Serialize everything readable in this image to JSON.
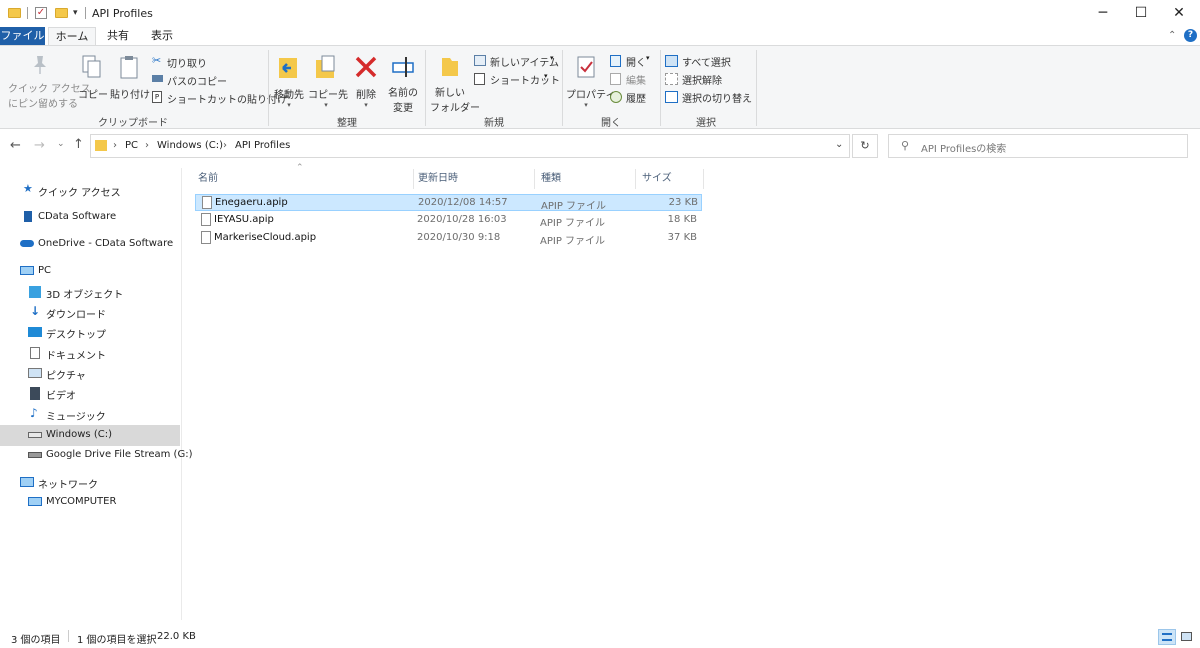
{
  "window": {
    "title": "API Profiles",
    "controls": {
      "minimize": "─",
      "maximize": "☐",
      "close": "✕"
    }
  },
  "ribbon": {
    "tabs": [
      "ファイル",
      "ホーム",
      "共有",
      "表示"
    ],
    "active_tab": "ホーム",
    "clipboard": {
      "pin_line1": "クイック アクセス",
      "pin_line2": "にピン留めする",
      "copy": "コピー",
      "paste": "貼り付け",
      "cut": "切り取り",
      "copy_path": "パスのコピー",
      "paste_shortcut": "ショートカットの貼り付け",
      "group": "クリップボード"
    },
    "organize": {
      "move_to": "移動先",
      "copy_to": "コピー先",
      "delete": "削除",
      "rename_line1": "名前の",
      "rename_line2": "変更",
      "group": "整理"
    },
    "new": {
      "new_folder_line1": "新しい",
      "new_folder_line2": "フォルダー",
      "new_item": "新しいアイテム",
      "shortcut": "ショートカット",
      "group": "新規"
    },
    "open": {
      "properties": "プロパティ",
      "open": "開く",
      "edit": "編集",
      "history": "履歴",
      "group": "開く"
    },
    "select": {
      "select_all": "すべて選択",
      "select_none": "選択解除",
      "invert": "選択の切り替え",
      "group": "選択"
    }
  },
  "address": {
    "breadcrumb": [
      "PC",
      "Windows (C:)",
      "API Profiles"
    ],
    "search_placeholder": "API Profilesの検索"
  },
  "nav": {
    "quick_access": "クイック アクセス",
    "cdata": "CData Software",
    "onedrive": "OneDrive - CData Software",
    "pc": "PC",
    "objects3d": "3D オブジェクト",
    "downloads": "ダウンロード",
    "desktop": "デスクトップ",
    "documents": "ドキュメント",
    "pictures": "ピクチャ",
    "videos": "ビデオ",
    "music": "ミュージック",
    "windows_c": "Windows (C:)",
    "gdrive": "Google Drive File Stream (G:)",
    "network": "ネットワーク",
    "mycomputer": "MYCOMPUTER"
  },
  "columns": {
    "name": "名前",
    "modified": "更新日時",
    "type": "種類",
    "size": "サイズ"
  },
  "files": [
    {
      "name": "Enegaeru.apip",
      "modified": "2020/12/08 14:57",
      "type": "APIP ファイル",
      "size": "23 KB",
      "selected": true
    },
    {
      "name": "IEYASU.apip",
      "modified": "2020/10/28 16:03",
      "type": "APIP ファイル",
      "size": "18 KB",
      "selected": false
    },
    {
      "name": "MarkeriseCloud.apip",
      "modified": "2020/10/30 9:18",
      "type": "APIP ファイル",
      "size": "37 KB",
      "selected": false
    }
  ],
  "status": {
    "item_count": "3 個の項目",
    "selection": "1 個の項目を選択",
    "selection_size": "22.0 KB"
  },
  "colors": {
    "accent": "#1f5fa8",
    "selection": "#cce8ff",
    "folder": "#f4c84a"
  }
}
